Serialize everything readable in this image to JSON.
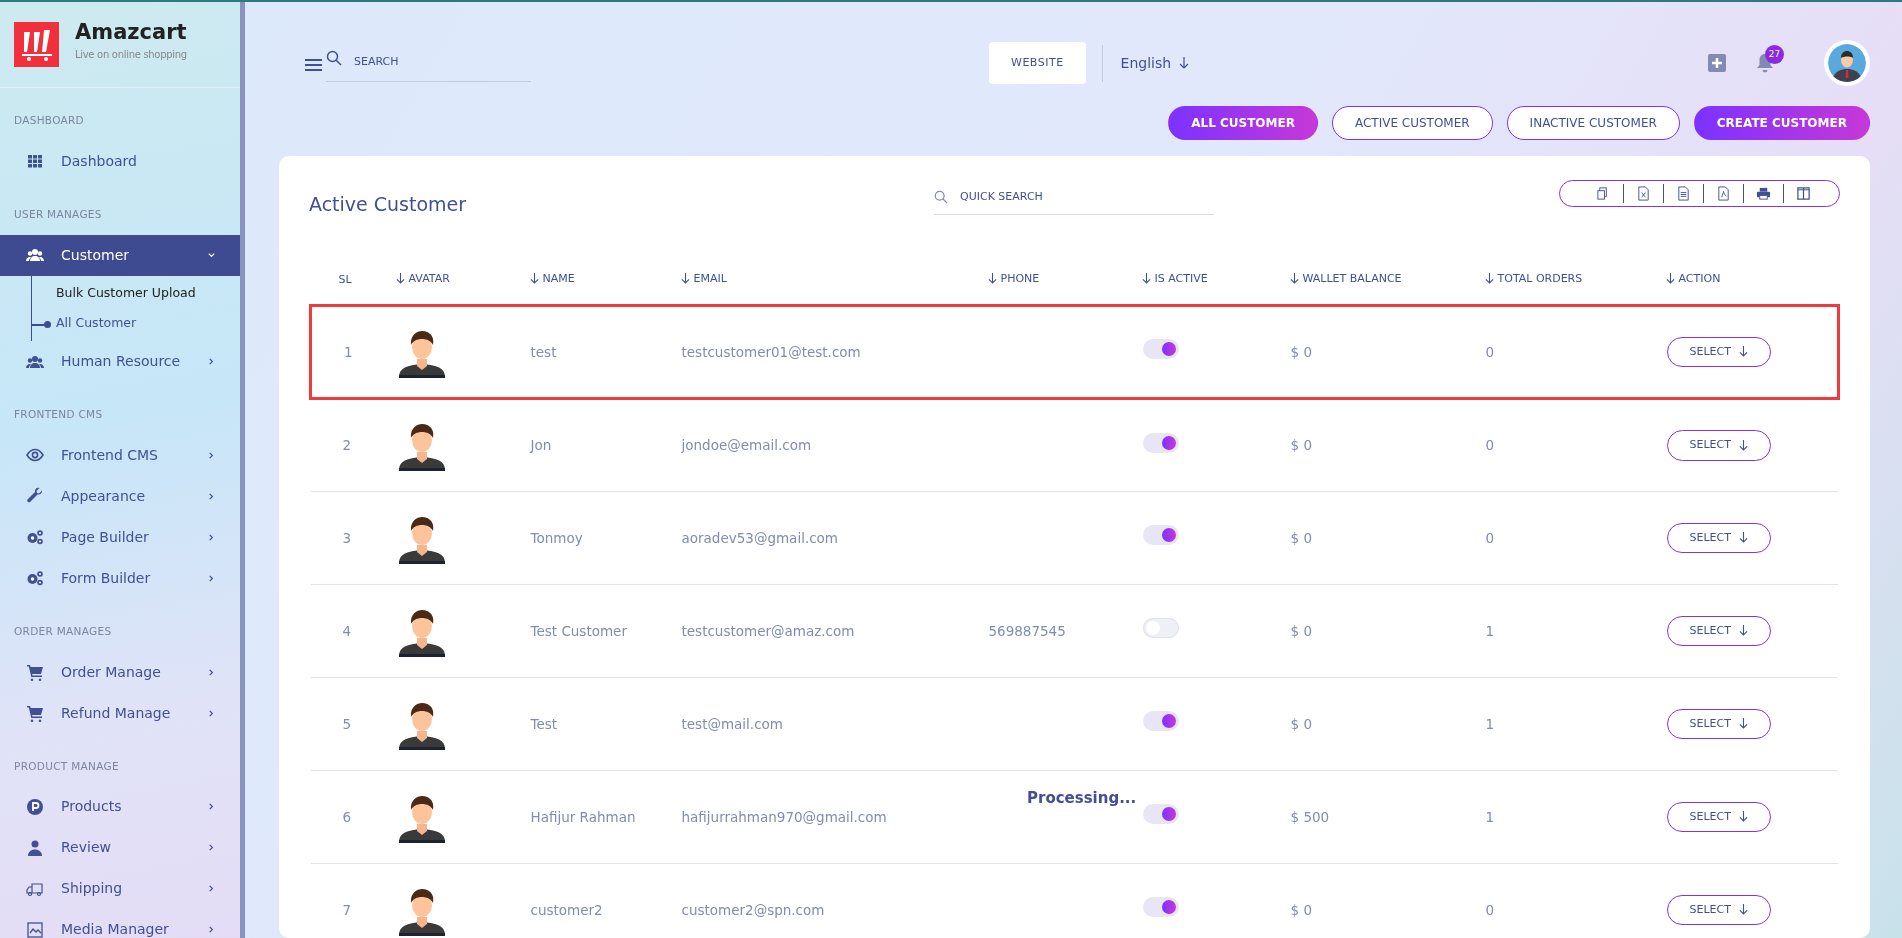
{
  "brand": {
    "name": "Amazcart",
    "tagline": "Live on online shopping"
  },
  "sidebar": [
    {
      "heading": "DASHBOARD",
      "items": [
        {
          "label": "Dashboard",
          "expanded": false,
          "has_arrow": false
        }
      ]
    },
    {
      "heading": "USER MANAGES",
      "items": [
        {
          "label": "Customer",
          "expanded": true,
          "has_arrow": true,
          "children": [
            {
              "label": "Bulk Customer Upload",
              "selected": false
            },
            {
              "label": "All Customer",
              "selected": true
            }
          ]
        },
        {
          "label": "Human Resource",
          "expanded": false,
          "has_arrow": true
        }
      ]
    },
    {
      "heading": "FRONTEND CMS",
      "items": [
        {
          "label": "Frontend CMS",
          "expanded": false,
          "has_arrow": true
        },
        {
          "label": "Appearance",
          "expanded": false,
          "has_arrow": true
        },
        {
          "label": "Page Builder",
          "expanded": false,
          "has_arrow": true
        },
        {
          "label": "Form Builder",
          "expanded": false,
          "has_arrow": true
        }
      ]
    },
    {
      "heading": "ORDER MANAGES",
      "items": [
        {
          "label": "Order Manage",
          "expanded": false,
          "has_arrow": true
        },
        {
          "label": "Refund Manage",
          "expanded": false,
          "has_arrow": true
        }
      ]
    },
    {
      "heading": "PRODUCT MANAGE",
      "items": [
        {
          "label": "Products",
          "expanded": false,
          "has_arrow": true
        },
        {
          "label": "Review",
          "expanded": false,
          "has_arrow": true
        },
        {
          "label": "Shipping",
          "expanded": false,
          "has_arrow": true
        },
        {
          "label": "Media Manager",
          "expanded": false,
          "has_arrow": true
        }
      ]
    }
  ],
  "topbar": {
    "search_placeholder": "SEARCH",
    "website_button": "WEBSITE",
    "language": "English",
    "notification_count": "27"
  },
  "filter_buttons": [
    {
      "label": "ALL CUSTOMER",
      "selected": true
    },
    {
      "label": "ACTIVE CUSTOMER",
      "selected": false
    },
    {
      "label": "INACTIVE CUSTOMER",
      "selected": false
    },
    {
      "label": "CREATE CUSTOMER",
      "selected": true
    }
  ],
  "card": {
    "title": "Active Customer",
    "search_placeholder": "QUICK SEARCH",
    "processing_text": "Processing..."
  },
  "table": {
    "columns": [
      {
        "label": "SL",
        "sortable": false
      },
      {
        "label": "AVATAR",
        "sortable": true
      },
      {
        "label": "NAME",
        "sortable": true
      },
      {
        "label": "EMAIL",
        "sortable": true
      },
      {
        "label": "PHONE",
        "sortable": true
      },
      {
        "label": "IS ACTIVE",
        "sortable": true
      },
      {
        "label": "WALLET BALANCE",
        "sortable": true
      },
      {
        "label": "TOTAL ORDERS",
        "sortable": true
      },
      {
        "label": "ACTION",
        "sortable": true
      }
    ],
    "rows": [
      {
        "sl": "1",
        "name": "test",
        "email": "testcustomer01@test.com",
        "active": true,
        "wallet": "$ 0",
        "orders": "0",
        "action": "SELECT",
        "highlighted": true
      },
      {
        "sl": "2",
        "name": "Jon",
        "email": "jondoe@email.com",
        "active": true,
        "wallet": "$ 0",
        "orders": "0",
        "action": "SELECT",
        "highlighted": false
      },
      {
        "sl": "3",
        "name": "Tonmoy",
        "email": "aoradev53@gmail.com",
        "active": true,
        "wallet": "$ 0",
        "orders": "0",
        "action": "SELECT",
        "highlighted": false
      },
      {
        "sl": "4",
        "name": "Test Customer",
        "email": "testcustomer@amaz.com",
        "phone": "569887545",
        "active": false,
        "wallet": "$ 0",
        "orders": "1",
        "action": "SELECT",
        "highlighted": false
      },
      {
        "sl": "5",
        "name": "Test",
        "email": "test@mail.com",
        "active": true,
        "wallet": "$ 0",
        "orders": "1",
        "action": "SELECT",
        "highlighted": false
      },
      {
        "sl": "6",
        "name": "Hafijur Rahman",
        "email": "hafijurrahman970@gmail.com",
        "active": true,
        "wallet": "$ 500",
        "orders": "1",
        "action": "SELECT",
        "highlighted": false
      },
      {
        "sl": "7",
        "name": "customer2",
        "email": "customer2@spn.com",
        "active": true,
        "wallet": "$ 0",
        "orders": "0",
        "action": "SELECT",
        "highlighted": false
      }
    ]
  }
}
